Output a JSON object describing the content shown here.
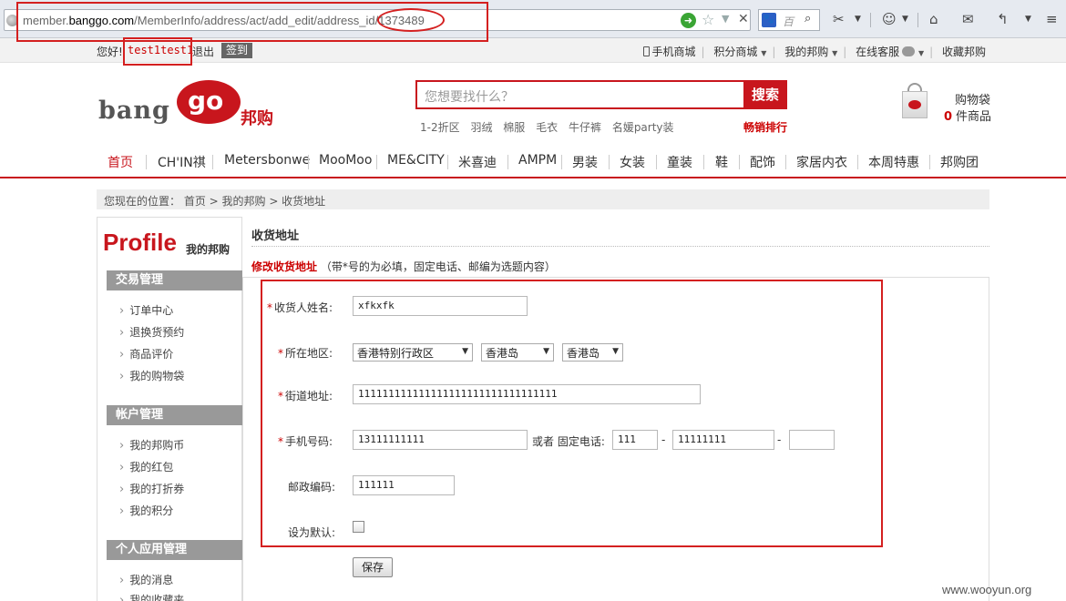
{
  "browser": {
    "url_prefix": "member.",
    "url_domain": "banggo.com",
    "url_path": "/MemberInfo/address/act/add_edit/address_id/1373489",
    "search_engine_text": "百"
  },
  "topbar": {
    "greeting": "您好!",
    "username": "test1test1",
    "logout": "退出",
    "signin": "签到",
    "links": [
      {
        "label": "手机商城"
      },
      {
        "label": "积分商城"
      },
      {
        "label": "我的邦购"
      },
      {
        "label": "在线客服"
      },
      {
        "label": "收藏邦购"
      }
    ]
  },
  "header": {
    "logo_text": "bang",
    "logo_go": "go",
    "logo_cn": "邦购",
    "search_placeholder": "您想要找什么？",
    "search_button": "搜索",
    "hot_words": [
      "1-2折区",
      "羽绒",
      "棉服",
      "毛衣",
      "牛仔裤",
      "名媛party装"
    ],
    "ranking": "畅销排行",
    "cart_label": "购物袋",
    "cart_count": "0",
    "cart_unit": "件商品"
  },
  "nav": {
    "items": [
      "首页",
      "CH'IN祺",
      "Metersbonwe",
      "MooMoo",
      "ME&CITY",
      "米喜迪",
      "AMPM",
      "男装",
      "女装",
      "童装",
      "鞋",
      "配饰",
      "家居内衣",
      "本周特惠",
      "邦购团"
    ]
  },
  "breadcrumb": "您现在的位置： 首页 > 我的邦购 > 收货地址",
  "sidebar": {
    "profile": "Profile",
    "profile_sub": "我的邦购",
    "sections": [
      {
        "title": "交易管理",
        "items": [
          "订单中心",
          "退换货预约",
          "商品评价",
          "我的购物袋"
        ]
      },
      {
        "title": "帐户管理",
        "items": [
          "我的邦购币",
          "我的红包",
          "我的打折券",
          "我的积分"
        ]
      },
      {
        "title": "个人应用管理",
        "items": [
          "我的消息",
          "我的收藏夹"
        ]
      }
    ]
  },
  "main": {
    "title": "收货地址",
    "subtitle": "修改收货地址",
    "note": "（带*号的为必填，固定电话、邮编为选题内容）",
    "form": {
      "name_label": "收货人姓名:",
      "name_value": "xfkxfk",
      "region_label": "所在地区:",
      "province": "香港特别行政区",
      "city": "香港岛",
      "district": "香港岛",
      "street_label": "街道地址:",
      "street_value": "111111111111111111111111111111111",
      "mobile_label": "手机号码:",
      "mobile_value": "13111111111",
      "or_tel": "或者 固定电话:",
      "tel_area": "111",
      "tel_number": "11111111",
      "tel_ext": "",
      "dash": "-",
      "zip_label": "邮政编码:",
      "zip_value": "111111",
      "default_label": "设为默认:",
      "save": "保存"
    }
  },
  "watermark": "www.wooyun.org",
  "colors": {
    "brand": "#c8161d",
    "highlight": "#d42020"
  }
}
